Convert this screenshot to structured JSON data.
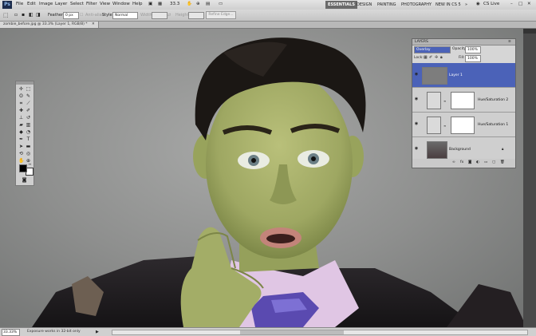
{
  "menubar": {
    "logo": "Ps",
    "items": [
      "File",
      "Edit",
      "Image",
      "Layer",
      "Select",
      "Filter",
      "View",
      "Window",
      "Help"
    ],
    "zoom": "33.3",
    "workspaces": [
      "ESSENTIALS",
      "DESIGN",
      "PAINTING",
      "PHOTOGRAPHY",
      "NEW IN CS 5"
    ],
    "more": "»",
    "cs_live": "CS Live"
  },
  "options": {
    "feather_label": "Feather:",
    "feather_value": "0 px",
    "antialias_label": "Anti-alias",
    "style_label": "Style:",
    "style_value": "Normal",
    "width_label": "Width:",
    "height_label": "Height:",
    "refine_edge": "Refine Edge..."
  },
  "document": {
    "tab_title": "zombie_before.jpg @ 33.3% (Layer 1, RGB/8) *",
    "zoom": "33.33%",
    "status": "Exposure works in 32-bit only"
  },
  "layers_panel": {
    "tab": "LAYERS",
    "blend_mode": "Overlay",
    "opacity_label": "Opacity:",
    "opacity": "100%",
    "lock_label": "Lock:",
    "fill_label": "Fill:",
    "fill": "100%",
    "layers": [
      {
        "name": "Layer 1",
        "selected": true
      },
      {
        "name": "Hue/Saturation 2",
        "selected": false
      },
      {
        "name": "Hue/Saturation 1",
        "selected": false
      },
      {
        "name": "Background",
        "selected": false
      }
    ]
  },
  "colors": {
    "selection": "#4b62b8",
    "skin": "#a6b06a",
    "shirt": "#e0c6e4"
  }
}
